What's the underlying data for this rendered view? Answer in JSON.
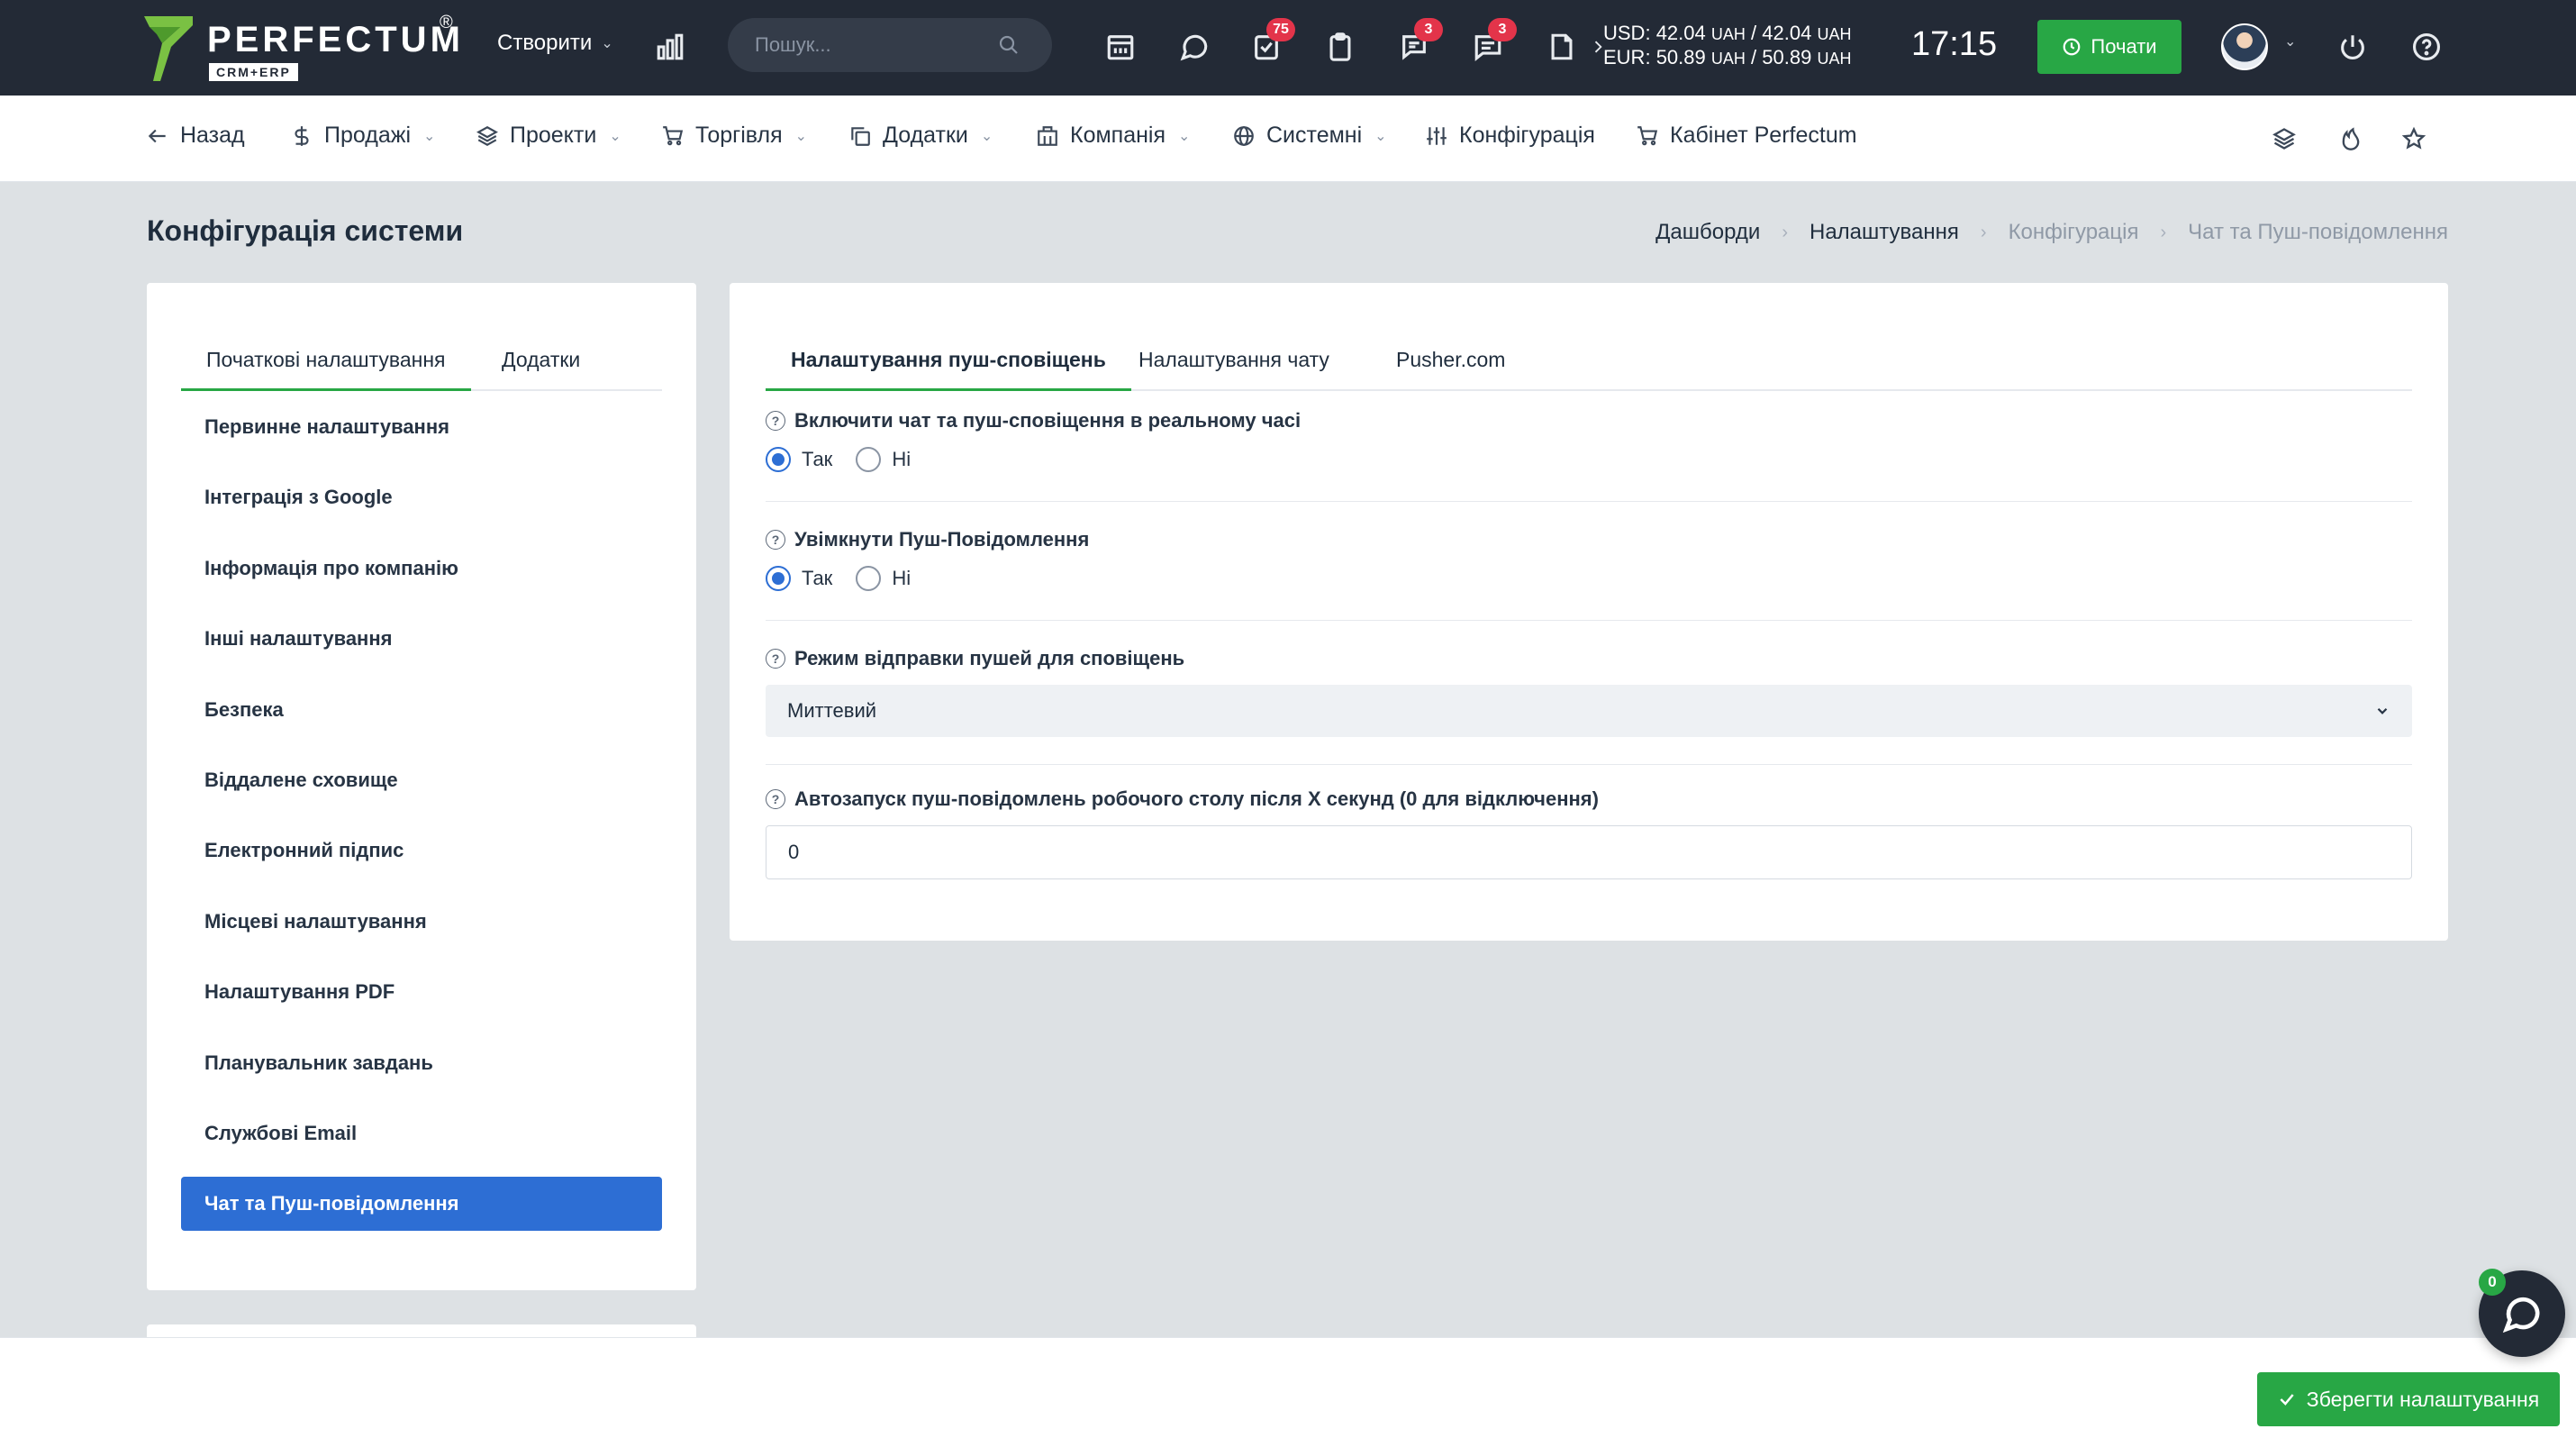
{
  "brand": {
    "name": "PERFECTUM",
    "sub": "CRM+ERP",
    "reg": "®",
    "accent": "#28a745"
  },
  "topbar": {
    "create_label": "Створити",
    "search_placeholder": "Пошук...",
    "badges": {
      "tasks": "75",
      "chat": "3",
      "messages": "3"
    },
    "currency": {
      "usd_label": "USD:",
      "usd_value": "42.04",
      "usd_unit1": "UAH",
      "usd_sep": "/",
      "usd_value2": "42.04",
      "usd_unit2": "UAH",
      "eur_label": "EUR:",
      "eur_value": "50.89",
      "eur_unit1": "UAH",
      "eur_sep": "/",
      "eur_value2": "50.89",
      "eur_unit2": "UAH"
    },
    "clock": "17:15",
    "start_label": "Почати",
    "icons": [
      "bar-chart-icon",
      "calendar-icon",
      "chat-icon",
      "tasks-icon",
      "clipboard-icon",
      "support-chat-icon",
      "message-icon",
      "file-icon",
      "chevron-right-icon",
      "power-icon",
      "help-icon"
    ]
  },
  "nav": {
    "back": "Назад",
    "sales": "Продажі",
    "projects": "Проекти",
    "trade": "Торгівля",
    "addons": "Додатки",
    "company": "Компанія",
    "system": "Системні",
    "config": "Конфігурація",
    "cabinet": "Кабінет Perfectum"
  },
  "page": {
    "title": "Конфігурація системи",
    "breadcrumb": [
      "Дашборди",
      "Налаштування",
      "Конфігурація",
      "Чат та Пуш-повідомлення"
    ]
  },
  "sidebar": {
    "tabs": [
      "Початкові налаштування",
      "Додатки"
    ],
    "items": [
      "Первинне налаштування",
      "Інтеграція з Google",
      "Інформація про компанію",
      "Інші налаштування",
      "Безпека",
      "Віддалене сховище",
      "Електронний підпис",
      "Місцеві налаштування",
      "Налаштування PDF",
      "Планувальник завдань",
      "Службові Email",
      "Чат та Пуш-повідомлення"
    ]
  },
  "main": {
    "tabs": [
      "Налаштування пуш-сповіщень",
      "Налаштування чату",
      "Pusher.com"
    ],
    "fields": {
      "realtime": {
        "label": "Включити чат та пуш-сповіщення в реальному часі",
        "yes": "Так",
        "no": "Ні"
      },
      "push": {
        "label": "Увімкнути Пуш-Повідомлення",
        "yes": "Так",
        "no": "Ні"
      },
      "mode": {
        "label": "Режим відправки пушей для сповіщень",
        "value": "Миттевий"
      },
      "autostart": {
        "label": "Автозапуск пуш-повідомлень робочого столу після X секунд (0 для відключення)",
        "value": "0"
      }
    }
  },
  "footer": {
    "save_label": "Зберегти налаштування"
  },
  "chat_widget": {
    "count": "0"
  }
}
